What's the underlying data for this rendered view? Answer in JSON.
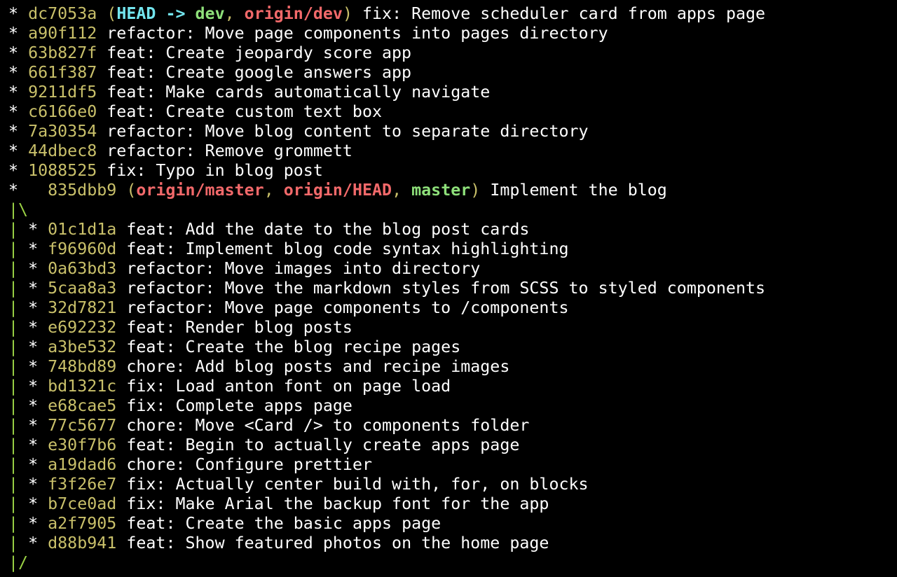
{
  "colors": {
    "background": "#000000",
    "hash": "#c9c06a",
    "head_ref": "#73e5ee",
    "local_branch": "#8ee07a",
    "remote_branch": "#f2696a",
    "graph_pipe": "#9bd245",
    "text": "#ffffff"
  },
  "log": {
    "main_commits": [
      {
        "hash": "dc7053a",
        "refs": {
          "open": "(",
          "head": "HEAD",
          "arrow": " -> ",
          "local1": "dev",
          "sep1": ", ",
          "remote1": "origin/dev",
          "close": ")"
        },
        "message": " fix: Remove scheduler card from apps page"
      },
      {
        "hash": "a90f112",
        "message": "refactor: Move page components into pages directory"
      },
      {
        "hash": "63b827f",
        "message": "feat: Create jeopardy score app"
      },
      {
        "hash": "661f387",
        "message": "feat: Create google answers app"
      },
      {
        "hash": "9211df5",
        "message": "feat: Make cards automatically navigate"
      },
      {
        "hash": "c6166e0",
        "message": "feat: Create custom text box"
      },
      {
        "hash": "7a30354",
        "message": "refactor: Move blog content to separate directory"
      },
      {
        "hash": "44dbec8",
        "message": "refactor: Remove grommett"
      },
      {
        "hash": "1088525",
        "message": "fix: Typo in blog post"
      }
    ],
    "merge_commit": {
      "hash": "835dbb9",
      "refs": {
        "open": "(",
        "remote1": "origin/master",
        "sep1": ", ",
        "remote2": "origin/HEAD",
        "sep2": ", ",
        "local1": "master",
        "close": ")"
      },
      "message": " Implement the blog"
    },
    "graph_open": "|\\",
    "graph_close": "|/",
    "branch_commits": [
      {
        "hash": "01c1d1a",
        "message": "feat: Add the date to the blog post cards"
      },
      {
        "hash": "f96960d",
        "message": "feat: Implement blog code syntax highlighting"
      },
      {
        "hash": "0a63bd3",
        "message": "refactor: Move images into directory"
      },
      {
        "hash": "5caa8a3",
        "message": "refactor: Move the markdown styles from SCSS to styled components"
      },
      {
        "hash": "32d7821",
        "message": "refactor: Move page components to /components"
      },
      {
        "hash": "e692232",
        "message": "feat: Render blog posts"
      },
      {
        "hash": "a3be532",
        "message": "feat: Create the blog recipe pages"
      },
      {
        "hash": "748bd89",
        "message": "chore: Add blog posts and recipe images"
      },
      {
        "hash": "bd1321c",
        "message": "fix: Load anton font on page load"
      },
      {
        "hash": "e68cae5",
        "message": "fix: Complete apps page"
      },
      {
        "hash": "77c5677",
        "message": "chore: Move <Card /> to components folder"
      },
      {
        "hash": "e30f7b6",
        "message": "feat: Begin to actually create apps page"
      },
      {
        "hash": "a19dad6",
        "message": "chore: Configure prettier"
      },
      {
        "hash": "f3f26e7",
        "message": "fix: Actually center build with, for, on blocks"
      },
      {
        "hash": "b7ce0ad",
        "message": "fix: Make Arial the backup font for the app"
      },
      {
        "hash": "a2f7905",
        "message": "feat: Create the basic apps page"
      },
      {
        "hash": "d88b941",
        "message": "feat: Show featured photos on the home page"
      }
    ]
  }
}
